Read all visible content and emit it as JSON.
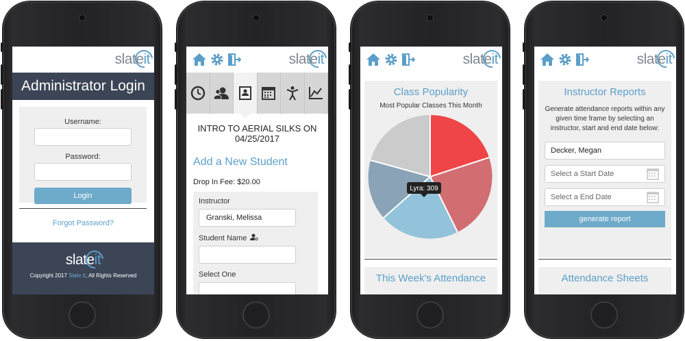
{
  "brand": {
    "logo_main": "slate",
    "logo_it": "it",
    "accent": "#5b9fc9",
    "dark": "#3c4556"
  },
  "screen1": {
    "title": "Administrator Login",
    "username_label": "Username:",
    "password_label": "Password:",
    "login_button": "Login",
    "forgot_link": "Forgot Password?",
    "copyright_prefix": "Copyright 2017 ",
    "copyright_brand": "Slate It",
    "copyright_suffix": ", All Rights Reserved"
  },
  "screen2": {
    "nav_icons": [
      "home-icon",
      "gear-icon",
      "logout-icon"
    ],
    "tabs": [
      "clock-icon",
      "users-icon",
      "contact-card-icon",
      "calendar-icon",
      "person-icon",
      "line-chart-icon"
    ],
    "active_tab": 2,
    "class_title": "INTRO TO AERIAL SILKS ON 04/25/2017",
    "section_title": "Add a New Student",
    "fee": "Drop In Fee: $20.00",
    "instructor_label": "Instructor",
    "instructor_value": "Granski, Melissa",
    "student_label": "Student Name",
    "select_label": "Select One"
  },
  "screen3": {
    "title": "Class Popularity",
    "subtitle": "Most Popular Classes This Month",
    "tooltip": "Lyra: 309",
    "second_title": "This Week's Attendance",
    "chart_colors": [
      "#f04547",
      "#d26e72",
      "#93c3da",
      "#8aa3b6",
      "#cbcbcb"
    ]
  },
  "screen4": {
    "title": "Instructor Reports",
    "description": "Generate attendance reports within any given time frame by selecting an instructor, start and end date below:",
    "instructor_value": "Decker, Megan",
    "start_placeholder": "Select a Start Date",
    "end_placeholder": "Select a End Date",
    "button": "generate report",
    "second_title": "Attendance Sheets"
  }
}
